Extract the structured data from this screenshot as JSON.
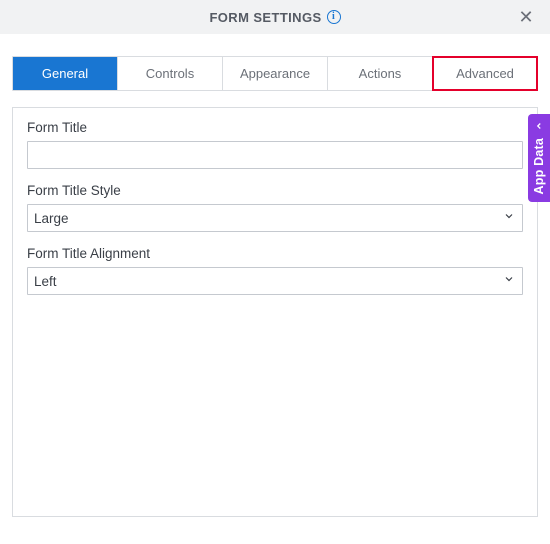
{
  "header": {
    "title": "FORM SETTINGS"
  },
  "tabs": {
    "general": "General",
    "controls": "Controls",
    "appearance": "Appearance",
    "actions": "Actions",
    "advanced": "Advanced"
  },
  "fields": {
    "formTitle": {
      "label": "Form Title",
      "value": ""
    },
    "formTitleStyle": {
      "label": "Form Title Style",
      "value": "Large"
    },
    "formTitleAlignment": {
      "label": "Form Title Alignment",
      "value": "Left"
    }
  },
  "sidePanel": {
    "label": "App Data"
  }
}
